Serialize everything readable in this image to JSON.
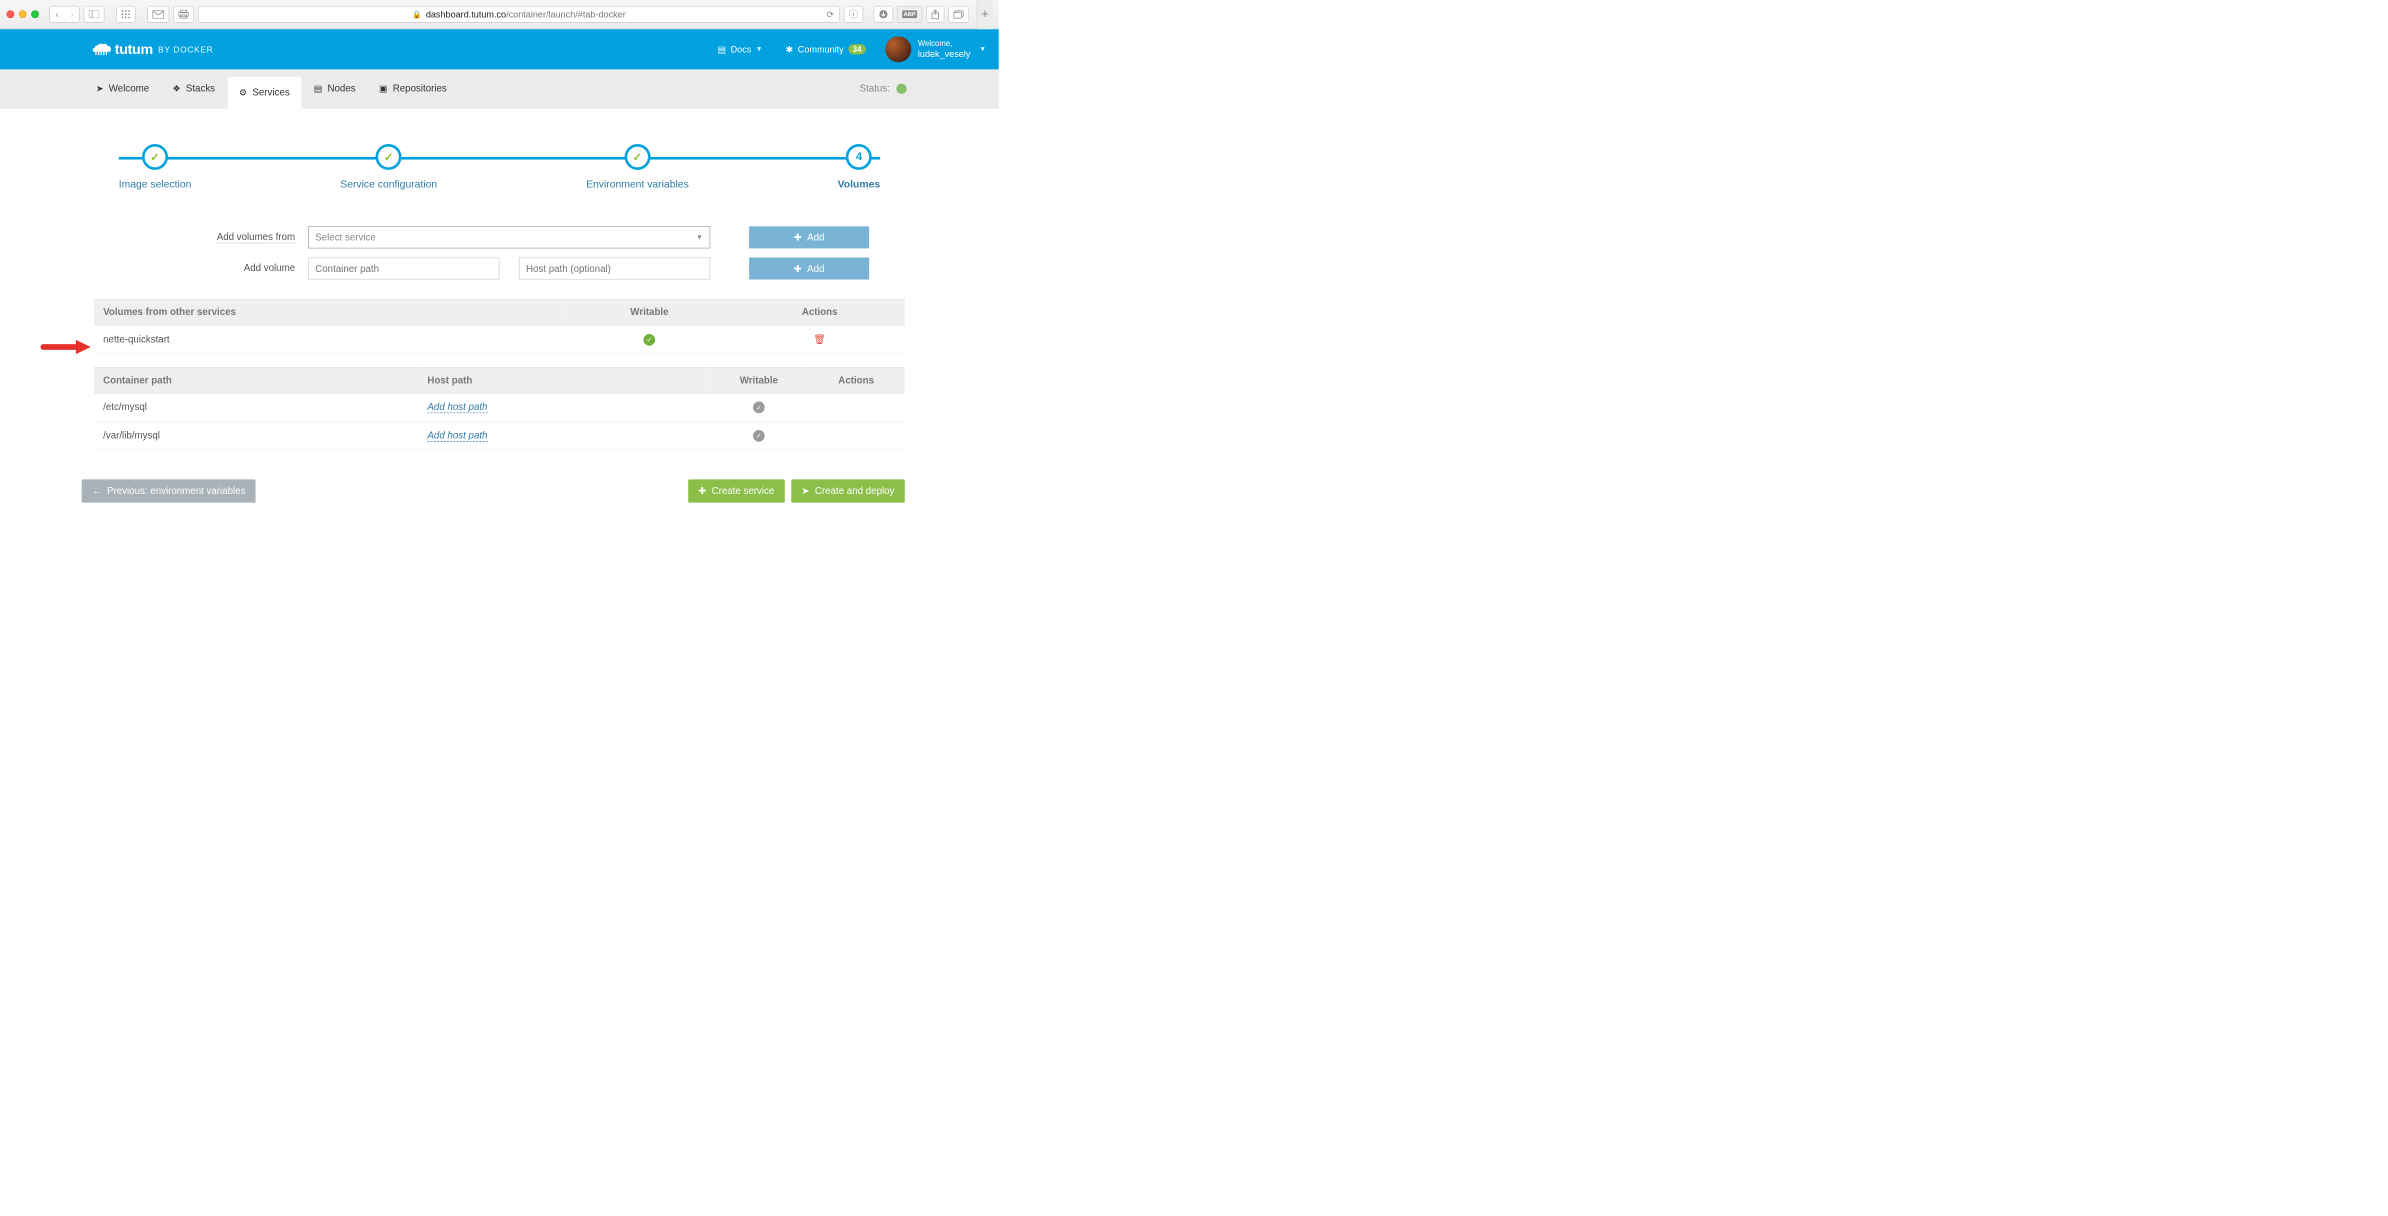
{
  "browser": {
    "url_secure": "🔒",
    "url_domain": "dashboard.tutum.co",
    "url_path": "/container/launch/#tab-docker"
  },
  "topbar": {
    "brand": "tutum",
    "brand_sub": "BY DOCKER",
    "docs": "Docs",
    "community": "Community",
    "community_count": "34",
    "welcome": "Welcome,",
    "username": "ludek_vesely"
  },
  "nav": {
    "welcome": "Welcome",
    "stacks": "Stacks",
    "services": "Services",
    "nodes": "Nodes",
    "repositories": "Repositories",
    "status_label": "Status:"
  },
  "wizard": {
    "step1": "Image selection",
    "step2": "Service configuration",
    "step3": "Environment variables",
    "step4": "Volumes",
    "step4_num": "4"
  },
  "form": {
    "volumes_from_label": "Add volumes from",
    "volumes_from_placeholder": "Select service",
    "volume_label": "Add volume",
    "container_path_placeholder": "Container path",
    "host_path_placeholder": "Host path (optional)",
    "add_btn": "Add"
  },
  "table1": {
    "h_name": "Volumes from other services",
    "h_writable": "Writable",
    "h_actions": "Actions",
    "rows": [
      {
        "name": "nette-quickstart"
      }
    ]
  },
  "table2": {
    "h_container": "Container path",
    "h_host": "Host path",
    "h_writable": "Writable",
    "h_actions": "Actions",
    "add_host_path": "Add host path",
    "rows": [
      {
        "container": "/etc/mysql"
      },
      {
        "container": "/var/lib/mysql"
      }
    ]
  },
  "footer": {
    "prev": "Previous: environment variables",
    "create_service": "Create service",
    "create_deploy": "Create and deploy"
  }
}
